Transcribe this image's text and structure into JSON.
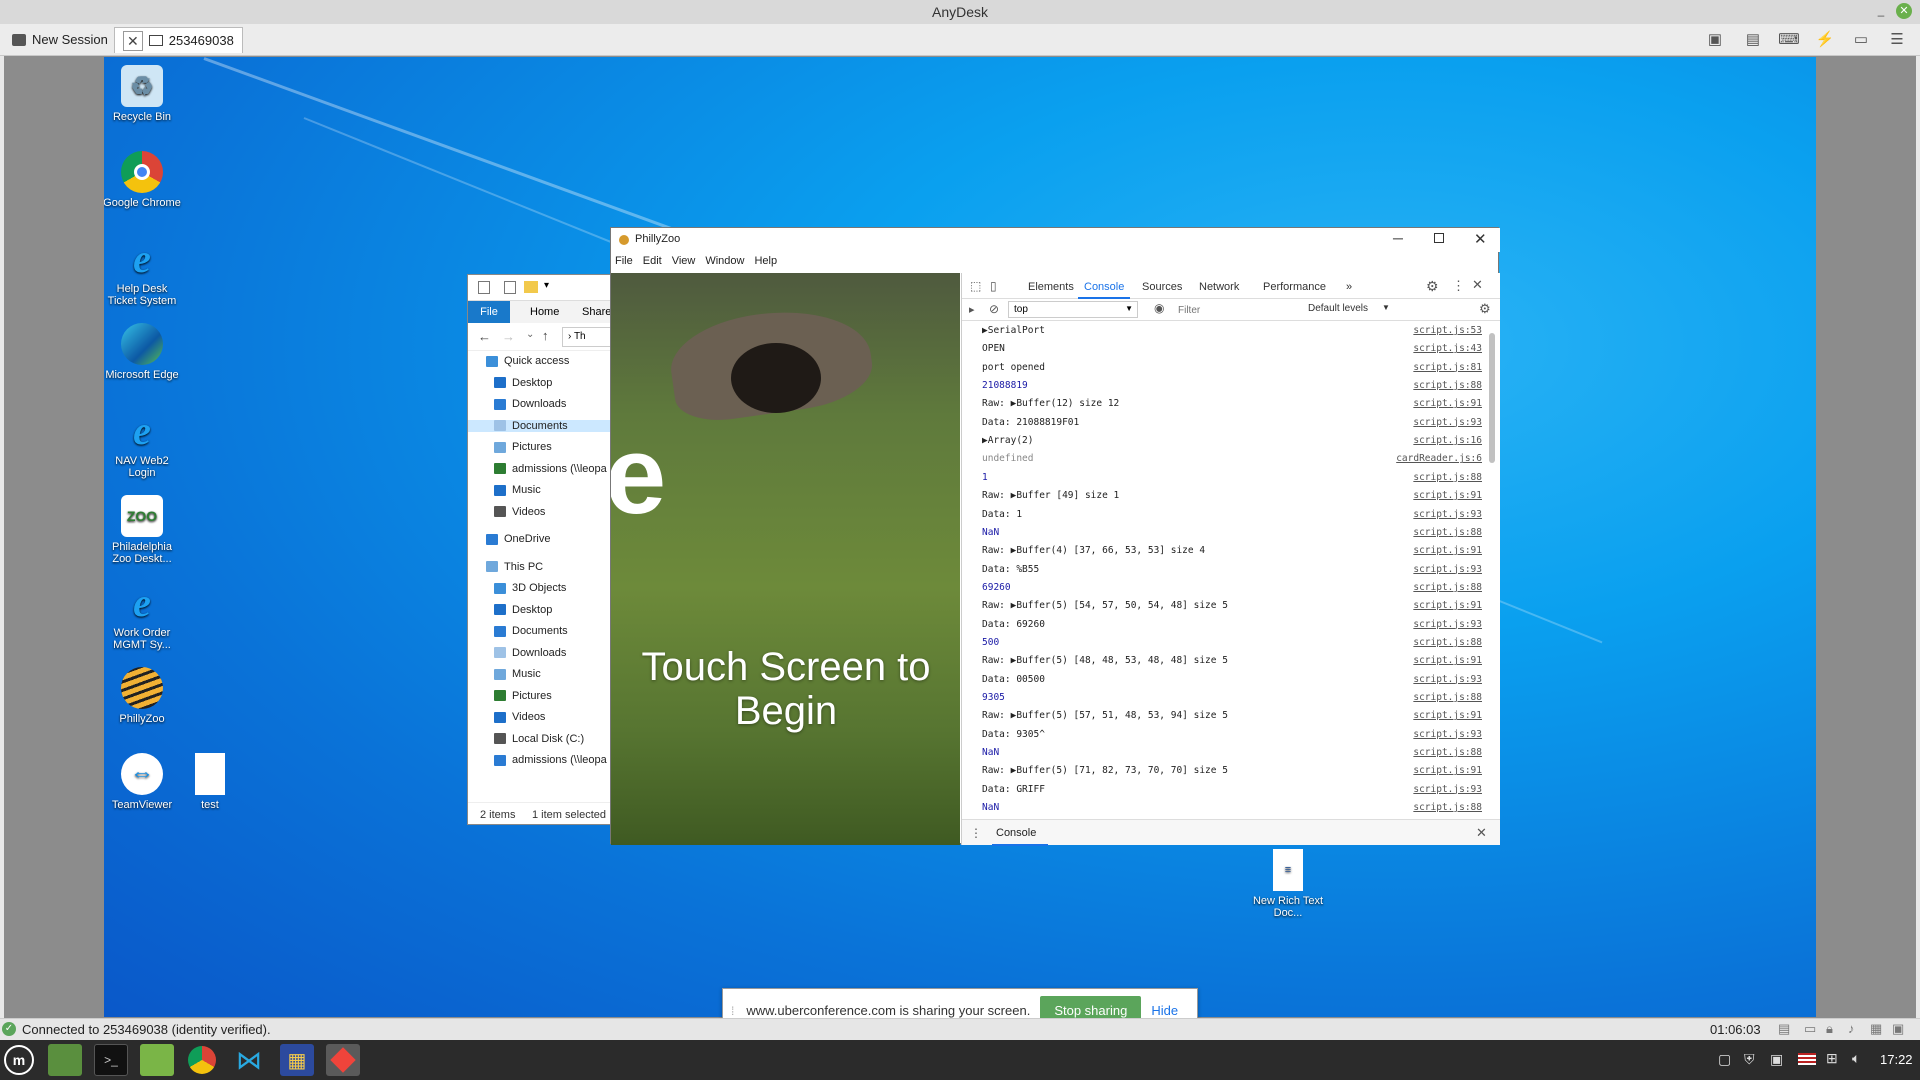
{
  "window": {
    "title": "AnyDesk"
  },
  "tabs": [
    {
      "label": "New Session"
    },
    {
      "label": "253469038"
    }
  ],
  "desktop_icons": [
    {
      "label": "Recycle Bin",
      "icon": "recycle-bin-icon"
    },
    {
      "label": "Google Chrome",
      "icon": "chrome-icon"
    },
    {
      "label": "Help Desk Ticket System",
      "icon": "ie-icon"
    },
    {
      "label": "Microsoft Edge",
      "icon": "edge-icon"
    },
    {
      "label": "NAV Web2 Login",
      "icon": "ie-icon"
    },
    {
      "label": "Philadelphia Zoo Deskt...",
      "icon": "zoo-icon"
    },
    {
      "label": "Work Order MGMT Sy...",
      "icon": "ie-icon"
    },
    {
      "label": "PhillyZoo",
      "icon": "tiger-icon"
    },
    {
      "label": "TeamViewer",
      "icon": "teamviewer-icon"
    },
    {
      "label": "test",
      "icon": "file-icon"
    },
    {
      "label": "New Rich Text Doc...",
      "icon": "rtf-icon"
    }
  ],
  "explorer": {
    "ribbon_tabs": [
      "File",
      "Home",
      "Share"
    ],
    "path": "Th",
    "nav": [
      {
        "label": "Quick access",
        "indent": 0
      },
      {
        "label": "Desktop",
        "indent": 1
      },
      {
        "label": "Downloads",
        "indent": 1
      },
      {
        "label": "Documents",
        "indent": 1,
        "selected": true
      },
      {
        "label": "Pictures",
        "indent": 1
      },
      {
        "label": "admissions (\\\\leopa",
        "indent": 1
      },
      {
        "label": "Music",
        "indent": 1
      },
      {
        "label": "Videos",
        "indent": 1
      },
      {
        "label": "OneDrive",
        "indent": 0
      },
      {
        "label": "This PC",
        "indent": 0
      },
      {
        "label": "3D Objects",
        "indent": 1
      },
      {
        "label": "Desktop",
        "indent": 1
      },
      {
        "label": "Documents",
        "indent": 1
      },
      {
        "label": "Downloads",
        "indent": 1
      },
      {
        "label": "Music",
        "indent": 1
      },
      {
        "label": "Pictures",
        "indent": 1
      },
      {
        "label": "Videos",
        "indent": 1
      },
      {
        "label": "Local Disk (C:)",
        "indent": 1
      },
      {
        "label": "admissions (\\\\leopa",
        "indent": 1
      }
    ],
    "status_items": "2 items",
    "status_selected": "1 item selected"
  },
  "app": {
    "title": "PhillyZoo",
    "menu": [
      "File",
      "Edit",
      "View",
      "Window",
      "Help"
    ],
    "video_text": "Touch Screen to Begin",
    "video_letter": "e"
  },
  "devtools": {
    "tabs": [
      "Elements",
      "Console",
      "Sources",
      "Network",
      "Performance"
    ],
    "active_tab": "Console",
    "context": "top",
    "filter_placeholder": "Filter",
    "levels": "Default levels",
    "drawer_tab": "Console",
    "rows": [
      {
        "text": "▶SerialPort",
        "src": "script.js:53",
        "cls": ""
      },
      {
        "text": "OPEN",
        "src": "script.js:43",
        "cls": ""
      },
      {
        "text": "port opened",
        "src": "script.js:81",
        "cls": ""
      },
      {
        "text": "21088819",
        "src": "script.js:88",
        "cls": "num"
      },
      {
        "text": "Raw:  ▶Buffer(12) size 12",
        "src": "script.js:91",
        "cls": ""
      },
      {
        "text": "Data:  21088819F01",
        "src": "script.js:93",
        "cls": ""
      },
      {
        "text": "▶Array(2)",
        "src": "script.js:16",
        "cls": ""
      },
      {
        "text": "undefined",
        "src": "cardReader.js:6",
        "cls": "undef"
      },
      {
        "text": "1",
        "src": "script.js:88",
        "cls": "num"
      },
      {
        "text": "Raw:  ▶Buffer [49] size 1",
        "src": "script.js:91",
        "cls": ""
      },
      {
        "text": "Data:  1",
        "src": "script.js:93",
        "cls": ""
      },
      {
        "text": "NaN",
        "src": "script.js:88",
        "cls": "num"
      },
      {
        "text": "Raw:  ▶Buffer(4) [37, 66, 53, 53] size 4",
        "src": "script.js:91",
        "cls": ""
      },
      {
        "text": "Data:  %B55",
        "src": "script.js:93",
        "cls": ""
      },
      {
        "text": "69260",
        "src": "script.js:88",
        "cls": "num"
      },
      {
        "text": "Raw:  ▶Buffer(5) [54, 57, 50, 54, 48] size 5",
        "src": "script.js:91",
        "cls": ""
      },
      {
        "text": "Data:  69260",
        "src": "script.js:93",
        "cls": ""
      },
      {
        "text": "500",
        "src": "script.js:88",
        "cls": "num"
      },
      {
        "text": "Raw:  ▶Buffer(5) [48, 48, 53, 48, 48] size 5",
        "src": "script.js:91",
        "cls": ""
      },
      {
        "text": "Data:  00500",
        "src": "script.js:93",
        "cls": ""
      },
      {
        "text": "9305",
        "src": "script.js:88",
        "cls": "num"
      },
      {
        "text": "Raw:  ▶Buffer(5) [57, 51, 48, 53, 94] size 5",
        "src": "script.js:91",
        "cls": ""
      },
      {
        "text": "Data:  9305^",
        "src": "script.js:93",
        "cls": ""
      },
      {
        "text": "NaN",
        "src": "script.js:88",
        "cls": "num"
      },
      {
        "text": "Raw:  ▶Buffer(5) [71, 82, 73, 70, 70] size 5",
        "src": "script.js:91",
        "cls": ""
      },
      {
        "text": "Data:  GRIFF",
        "src": "script.js:93",
        "cls": ""
      },
      {
        "text": "NaN",
        "src": "script.js:88",
        "cls": "num"
      }
    ]
  },
  "share_banner": {
    "message": "www.uberconference.com is sharing your screen.",
    "stop": "Stop sharing",
    "hide": "Hide"
  },
  "status": {
    "connection": "Connected to 253469038 (identity verified).",
    "timer": "01:06:03"
  },
  "taskbar": {
    "clock": "17:22"
  },
  "colors": {
    "desktop": "#0a8fe8",
    "accent_green": "#5ba55b",
    "devtools_blue": "#1a73e8"
  }
}
